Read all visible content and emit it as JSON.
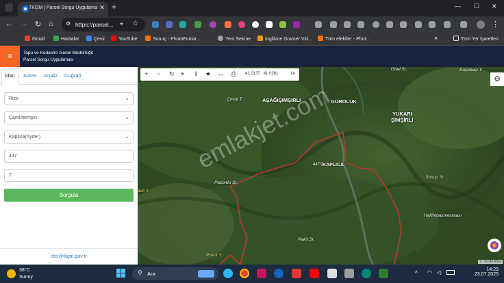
{
  "browser": {
    "tab_title": "TKGM | Parsel Sorgu Uygulaması",
    "new_tab_symbol": "+",
    "close_tab_symbol": "✕",
    "url": "https://parsel...",
    "win_min": "—",
    "win_max": "☐",
    "win_close": "✕"
  },
  "bookmarks": {
    "items": [
      {
        "label": "Gmail",
        "color": "#ea4335"
      },
      {
        "label": "Haritalar",
        "color": "#34a853"
      },
      {
        "label": "Çevir",
        "color": "#4285f4"
      },
      {
        "label": "YouTube",
        "color": "#ff0000"
      },
      {
        "label": "Sonuç - PhotoFuniar...",
        "color": "#ff6f00"
      },
      {
        "label": "Yeni Sekme",
        "color": "#9e9e9e"
      },
      {
        "label": "İngilizce Gramer Vid...",
        "color": "#ff9800"
      },
      {
        "label": "Tüm efektler - Phot...",
        "color": "#ff6f00"
      }
    ],
    "more": "»",
    "all_bookmarks": "Tüm Yer İşaretleri"
  },
  "app": {
    "menu_icon": "≡",
    "title_line1": "Tapu ve Kadastro Genel Müdürlüğü",
    "title_line2": "Parsel Sorgu Uygulaması"
  },
  "panel": {
    "tabs": [
      "İdari",
      "Adres",
      "Analiz",
      "Coğrafi"
    ],
    "province": "Rize",
    "district": "Çamlıhemşin",
    "neighborhood": "Kaplıca(Ayder)",
    "block": "447",
    "parcel": "2",
    "query_button": "Sorgula",
    "email": "cbs@tkgm.gov.tr",
    "caret": "⌄"
  },
  "map": {
    "coords": "41.0137 : 41.0381",
    "zoom": "14",
    "tools": {
      "zoom_in": "+",
      "zoom_out": "−",
      "refresh": "↻",
      "locate": "⌖",
      "info": "i",
      "bookmark": "★",
      "measure": "↔",
      "print": "⎙"
    },
    "settings": "⚙",
    "labels": {
      "glad": "Glad Sr.",
      "kayabasi": "Kayabaşı Y.",
      "covut": "Çovut T.",
      "asagisimsirli": "AŞAĞIŞIMŞIRLI",
      "guroluk": "GÜROLUK",
      "yukari1": "YUKARI",
      "yukari2": "ŞİMŞİRLİ",
      "kaplica": "KAPLICA",
      "parcel_no": "447/2",
      "pasordu": "Paşordu Sr.",
      "sonup": "Sonup Sr.",
      "hallimbasmezraasi": "Hallimbasmezraası",
      "pakit": "Pakit Sr.",
      "avit": "avit Y.",
      "pokut": "Pokut Y."
    },
    "watermark": "emlakjet.com",
    "copyright": "© TKGM Atlas"
  },
  "taskbar": {
    "temp": "38°C",
    "weather": "Sunny",
    "search": "Ara",
    "time": "14:29",
    "date": "23.07.2025"
  }
}
